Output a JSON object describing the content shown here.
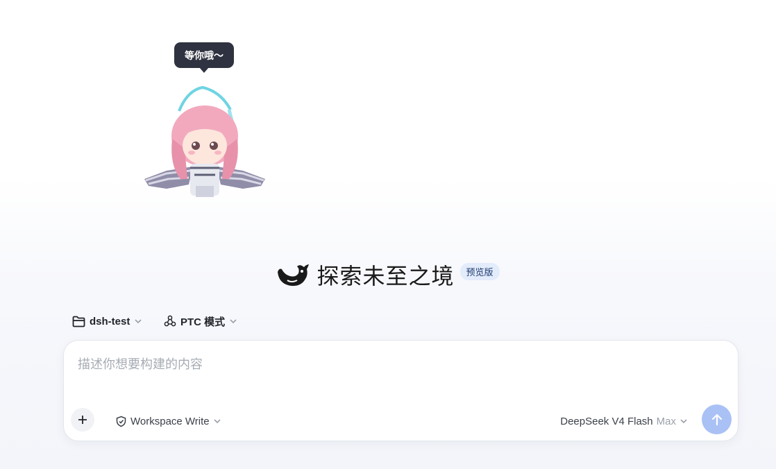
{
  "mascot": {
    "speech": "等你哦～"
  },
  "hero": {
    "title": "探索未至之境",
    "badge": "预览版",
    "logo_icon": "deepseek-whale-icon"
  },
  "selectors": {
    "folder": {
      "label": "dsh-test",
      "icon": "folder-icon"
    },
    "mode": {
      "label": "PTC 模式",
      "icon": "nodes-icon"
    }
  },
  "composer": {
    "placeholder": "描述你想要构建的内容",
    "value": "",
    "add_icon": "plus-icon",
    "permission": {
      "label": "Workspace Write",
      "icon": "shield-edit-icon"
    },
    "model": {
      "name": "DeepSeek V4 Flash",
      "level": "Max"
    },
    "send_icon": "arrow-up-icon"
  },
  "colors": {
    "accent": "#a9c1f5",
    "badge_bg": "#e3ecfb",
    "tooltip_bg": "#2f3240"
  }
}
